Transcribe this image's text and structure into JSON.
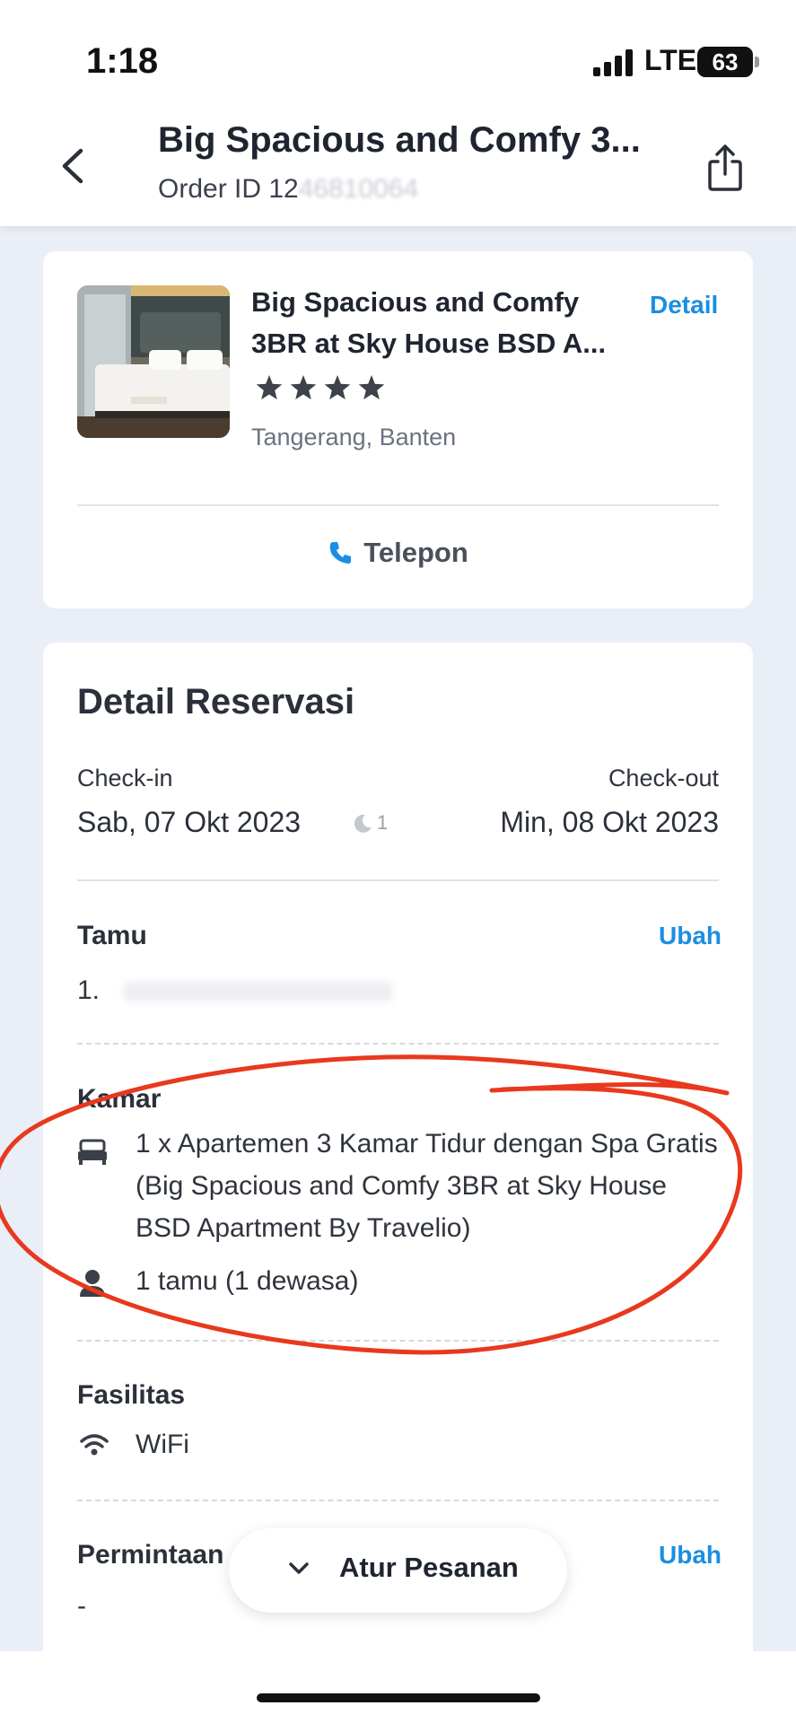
{
  "status_bar": {
    "time": "1:18",
    "network": "LTE",
    "battery": "63"
  },
  "header": {
    "title": "Big Spacious and Comfy 3...",
    "order_id_prefix": "Order ID 12",
    "order_id_hidden": "46810064"
  },
  "hotel": {
    "name": "Big Spacious and Comfy 3BR at Sky House BSD A...",
    "detail_label": "Detail",
    "star_rating": 4,
    "location": "Tangerang, Banten",
    "phone_label": "Telepon"
  },
  "reservation": {
    "title": "Detail Reservasi",
    "checkin_label": "Check-in",
    "checkin_date": "Sab, 07 Okt 2023",
    "checkout_label": "Check-out",
    "checkout_date": "Min, 08 Okt 2023",
    "nights": "1",
    "guest": {
      "label": "Tamu",
      "edit_label": "Ubah",
      "item_number": "1."
    },
    "room": {
      "label": "Kamar",
      "description": "1 x Apartemen 3 Kamar Tidur dengan Spa Gratis (Big Spacious and Comfy 3BR at Sky House BSD Apartment By Travelio)",
      "guests": "1 tamu (1 dewasa)"
    },
    "facilities": {
      "label": "Fasilitas",
      "items": [
        "WiFi"
      ]
    },
    "request": {
      "label": "Permintaan",
      "edit_label": "Ubah",
      "value": "-"
    }
  },
  "manage_button": {
    "label": "Atur Pesanan"
  },
  "colors": {
    "accent": "#1a8ee2",
    "annotation": "#e8391e",
    "background": "#e9eef7"
  }
}
